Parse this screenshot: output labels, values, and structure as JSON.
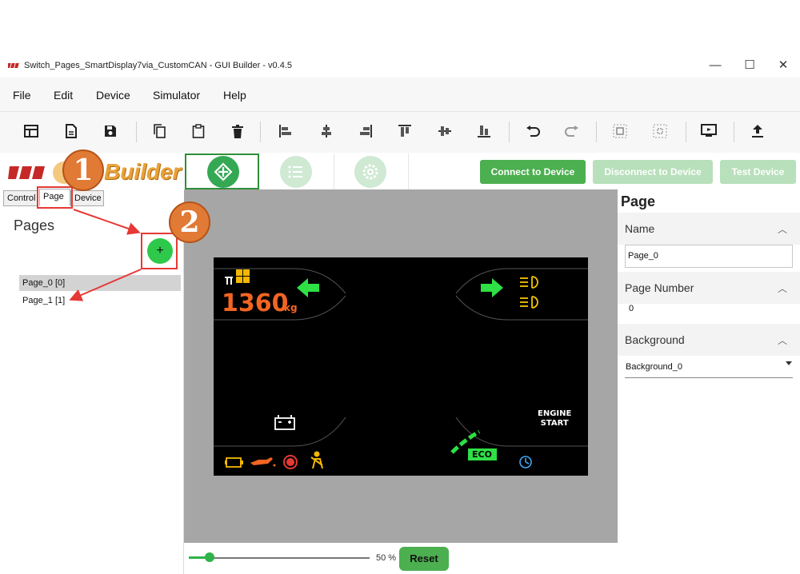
{
  "window": {
    "title": "Switch_Pages_SmartDisplay7via_CustomCAN - GUI Builder - v0.4.5",
    "minimize": "—",
    "maximize": "☐",
    "close": "✕"
  },
  "menu": {
    "file": "File",
    "edit": "Edit",
    "device": "Device",
    "simulator": "Simulator",
    "help": "Help"
  },
  "toolbar": {
    "icons": [
      "new-layout-icon",
      "new-document-icon",
      "save-icon",
      "copy-icon",
      "paste-icon",
      "delete-icon",
      "align-left-icon",
      "align-center-icon",
      "align-right-icon",
      "align-top-icon",
      "align-middle-icon",
      "align-bottom-icon",
      "undo-icon",
      "redo-icon",
      "group-icon",
      "ungroup-icon",
      "preview-icon",
      "upload-icon"
    ]
  },
  "brand": {
    "text": "Builder"
  },
  "header_buttons": {
    "connect": "Connect to Device",
    "disconnect": "Disconnect to Device",
    "test": "Test Device"
  },
  "left_tabs": {
    "control": "Control",
    "page": "Page",
    "device": "Device"
  },
  "pages": {
    "title": "Pages",
    "add_label": "+",
    "items": [
      "Page_0 [0]",
      "Page_1 [1]"
    ]
  },
  "display": {
    "weight_value": "1360",
    "weight_unit": "kg",
    "engine_start": "ENGINE\nSTART",
    "eco": "ECO"
  },
  "zoom": {
    "value": "50 %",
    "level_percent": 50,
    "reset": "Reset"
  },
  "properties": {
    "title": "Page",
    "name_label": "Name",
    "name_value": "Page_0",
    "page_number_label": "Page Number",
    "page_number_value": "0",
    "background_label": "Background",
    "background_value": "Background_0"
  },
  "callouts": {
    "one": "1",
    "two": "2"
  },
  "colors": {
    "accent_green": "#4caf50",
    "callout_orange": "#e07a35",
    "highlight_red": "#e53935"
  }
}
